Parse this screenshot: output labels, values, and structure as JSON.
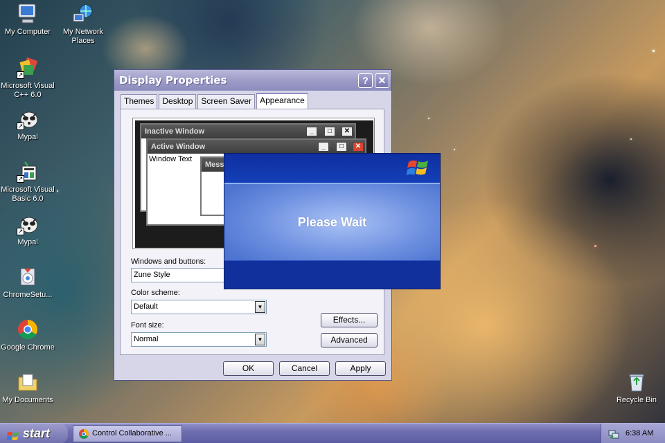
{
  "desktop": {
    "icons": [
      {
        "label_line1": "My Computer",
        "label_line2": "",
        "icon": "computer-icon"
      },
      {
        "label_line1": "My Network",
        "label_line2": "Places",
        "icon": "network-icon"
      },
      {
        "label_line1": "Microsoft Visual",
        "label_line2": "C++ 6.0",
        "icon": "vcpp-icon"
      },
      {
        "label_line1": "Mypal",
        "label_line2": "",
        "icon": "mypal-icon"
      },
      {
        "label_line1": "Microsoft Visual",
        "label_line2": "Basic 6.0",
        "icon": "vb-icon"
      },
      {
        "label_line1": "Mypal",
        "label_line2": "",
        "icon": "mypal-icon"
      },
      {
        "label_line1": "ChromeSetu...",
        "label_line2": "",
        "icon": "installer-icon"
      },
      {
        "label_line1": "Google Chrome",
        "label_line2": "",
        "icon": "chrome-icon"
      },
      {
        "label_line1": "My Documents",
        "label_line2": "",
        "icon": "documents-icon"
      },
      {
        "label_line1": "Recycle Bin",
        "label_line2": "",
        "icon": "recycle-bin-icon"
      }
    ]
  },
  "dialog": {
    "title": "Display Properties",
    "help_glyph": "?",
    "close_glyph": "✕",
    "tabs": [
      "Themes",
      "Desktop",
      "Screen Saver",
      "Appearance"
    ],
    "active_tab": "Appearance",
    "preview": {
      "inactive_title": "Inactive Window",
      "active_title": "Active Window",
      "window_text": "Window Text",
      "message_title": "Mess..."
    },
    "windows_buttons_label": "Windows and buttons:",
    "windows_buttons_value": "Zune Style",
    "color_scheme_label": "Color scheme:",
    "color_scheme_value": "Default",
    "font_size_label": "Font size:",
    "font_size_value": "Normal",
    "effects_label": "Effects...",
    "advanced_label": "Advanced",
    "ok_label": "OK",
    "cancel_label": "Cancel",
    "apply_label": "Apply"
  },
  "splash": {
    "text": "Please Wait"
  },
  "taskbar": {
    "start_label": "start",
    "task_label": "Control Collaborative ...",
    "clock": "6:38 AM"
  }
}
